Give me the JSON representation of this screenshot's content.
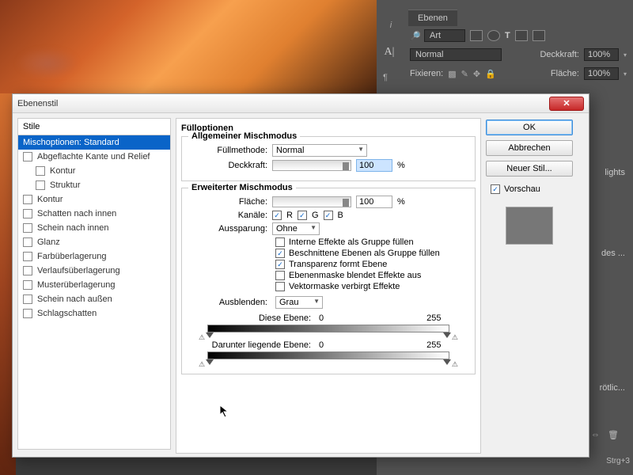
{
  "dialog": {
    "title": "Ebenenstil",
    "styles_header": "Stile",
    "styles_items": [
      {
        "label": "Mischoptionen: Standard",
        "checked": null,
        "selected": true,
        "indent": false
      },
      {
        "label": "Abgeflachte Kante und Relief",
        "checked": false,
        "selected": false,
        "indent": false
      },
      {
        "label": "Kontur",
        "checked": false,
        "selected": false,
        "indent": true
      },
      {
        "label": "Struktur",
        "checked": false,
        "selected": false,
        "indent": true
      },
      {
        "label": "Kontur",
        "checked": false,
        "selected": false,
        "indent": false
      },
      {
        "label": "Schatten nach innen",
        "checked": false,
        "selected": false,
        "indent": false
      },
      {
        "label": "Schein nach innen",
        "checked": false,
        "selected": false,
        "indent": false
      },
      {
        "label": "Glanz",
        "checked": false,
        "selected": false,
        "indent": false
      },
      {
        "label": "Farbüberlagerung",
        "checked": false,
        "selected": false,
        "indent": false
      },
      {
        "label": "Verlaufsüberlagerung",
        "checked": false,
        "selected": false,
        "indent": false
      },
      {
        "label": "Musterüberlagerung",
        "checked": false,
        "selected": false,
        "indent": false
      },
      {
        "label": "Schein nach außen",
        "checked": false,
        "selected": false,
        "indent": false
      },
      {
        "label": "Schlagschatten",
        "checked": false,
        "selected": false,
        "indent": false
      }
    ],
    "options": {
      "title": "Fülloptionen",
      "general": {
        "legend": "Allgemeiner Mischmodus",
        "mode_label": "Füllmethode:",
        "mode_value": "Normal",
        "opacity_label": "Deckkraft:",
        "opacity_value": "100",
        "pct": "%"
      },
      "advanced": {
        "legend": "Erweiterter Mischmodus",
        "fill_label": "Fläche:",
        "fill_value": "100",
        "pct": "%",
        "channels_label": "Kanäle:",
        "ch_r": "R",
        "ch_g": "G",
        "ch_b": "B",
        "knockout_label": "Aussparung:",
        "knockout_value": "Ohne",
        "cb1": "Interne Effekte als Gruppe füllen",
        "cb2": "Beschnittene Ebenen als Gruppe füllen",
        "cb3": "Transparenz formt Ebene",
        "cb4": "Ebenenmaske blendet Effekte aus",
        "cb5": "Vektormaske verbirgt Effekte"
      },
      "blendif": {
        "label": "Ausblenden:",
        "value": "Grau",
        "this_label": "Diese Ebene:",
        "this_low": "0",
        "this_high": "255",
        "under_label": "Darunter liegende Ebene:",
        "under_low": "0",
        "under_high": "255"
      }
    },
    "buttons": {
      "ok": "OK",
      "cancel": "Abbrechen",
      "new_style": "Neuer Stil...",
      "preview": "Vorschau"
    }
  },
  "sidepanel": {
    "tab": "Ebenen",
    "kind_label": "Art",
    "blend_mode": "Normal",
    "opacity_label": "Deckkraft:",
    "opacity_value": "100%",
    "lock_label": "Fixieren:",
    "fill_label": "Fläche:",
    "fill_value": "100%",
    "layer_frag1": "lights",
    "layer_frag2": "des ...",
    "layer_frag3": "rötlic...",
    "shortcut": "Strg+3"
  }
}
